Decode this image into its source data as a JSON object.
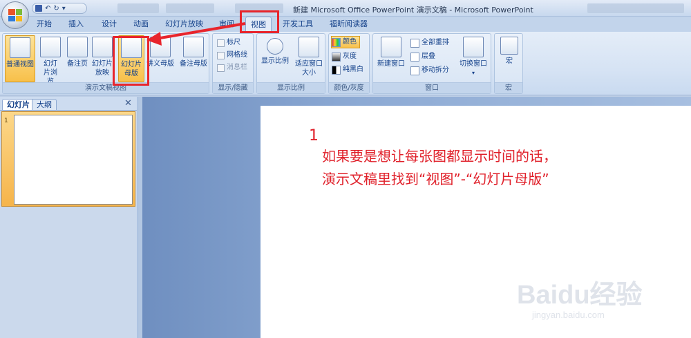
{
  "window": {
    "title": "新建 Microsoft Office PowerPoint 演示文稿 - Microsoft PowerPoint"
  },
  "qat": {
    "save_icon": "save-icon",
    "undo": "↶",
    "redo": "↻",
    "more": "▾"
  },
  "tabs": [
    {
      "label": "开始"
    },
    {
      "label": "插入"
    },
    {
      "label": "设计"
    },
    {
      "label": "动画"
    },
    {
      "label": "幻灯片放映"
    },
    {
      "label": "审阅"
    },
    {
      "label": "视图"
    },
    {
      "label": "开发工具"
    },
    {
      "label": "福昕阅读器"
    }
  ],
  "ribbon": {
    "views_group": {
      "label": "演示文稿视图",
      "buttons": [
        {
          "label": "普通视图"
        },
        {
          "label": "幻灯片浏览"
        },
        {
          "label": "备注页"
        },
        {
          "label": "幻灯片放映"
        },
        {
          "label": "幻灯片母版"
        },
        {
          "label": "讲义母版"
        },
        {
          "label": "备注母版"
        }
      ]
    },
    "show_group": {
      "label": "显示/隐藏",
      "items": [
        {
          "label": "标尺"
        },
        {
          "label": "网格线"
        },
        {
          "label": "消息栏"
        }
      ]
    },
    "zoom_group": {
      "label": "显示比例",
      "buttons": [
        {
          "label": "显示比例"
        },
        {
          "label": "适应窗口大小"
        }
      ]
    },
    "color_group": {
      "label": "颜色/灰度",
      "items": [
        {
          "label": "颜色"
        },
        {
          "label": "灰度"
        },
        {
          "label": "纯黑白"
        }
      ]
    },
    "window_group": {
      "label": "窗口",
      "new_window": "新建窗口",
      "items": [
        {
          "label": "全部重排"
        },
        {
          "label": "层叠"
        },
        {
          "label": "移动拆分"
        }
      ],
      "switch_window": "切换窗口"
    },
    "macro_group": {
      "label": "宏",
      "button": "宏"
    }
  },
  "panel": {
    "tab_slides": "幻灯片",
    "tab_outline": "大纲",
    "close": "✕",
    "slide_number": "1"
  },
  "slide": {
    "number": "1",
    "line1": "如果要是想让每张图都显示时间的话，",
    "line2": "演示文稿里找到“视图”-“幻灯片母版”"
  },
  "watermark": {
    "main": "Baidu经验",
    "sub": "jingyan.baidu.com"
  },
  "colors": {
    "highlight": "#e8252c",
    "selected": "#f8c04a",
    "ribbon": "#d6e3f4"
  }
}
